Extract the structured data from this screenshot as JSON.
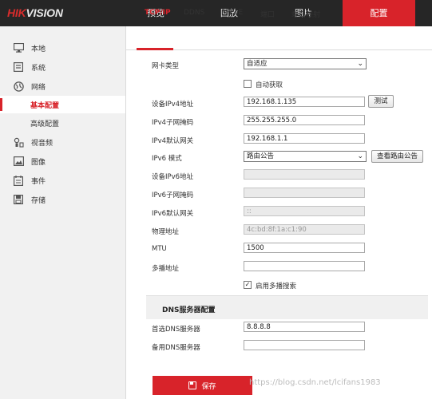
{
  "brand": {
    "logo_hik": "HIK",
    "logo_vision": "VISION"
  },
  "nav": {
    "tabs": [
      {
        "label": "预览"
      },
      {
        "label": "回放"
      },
      {
        "label": "图片"
      },
      {
        "label": "配置"
      }
    ],
    "active": "配置",
    "accent_color": "#d8232a"
  },
  "sidebar": {
    "items": [
      {
        "label": "本地",
        "icon": "monitor-icon"
      },
      {
        "label": "系统",
        "icon": "system-icon"
      },
      {
        "label": "网络",
        "icon": "globe-icon"
      },
      {
        "label": "基本配置",
        "icon": ""
      },
      {
        "label": "高级配置",
        "icon": ""
      },
      {
        "label": "视音频",
        "icon": "audio-video-icon"
      },
      {
        "label": "图像",
        "icon": "image-icon"
      },
      {
        "label": "事件",
        "icon": "event-icon"
      },
      {
        "label": "存储",
        "icon": "storage-icon"
      }
    ],
    "active": "基本配置"
  },
  "subtabs": {
    "items": [
      "TCP/IP",
      "DDNS",
      "PPPoE",
      "端口",
      "端口映射"
    ],
    "active": "TCP/IP"
  },
  "form": {
    "nic_type_label": "网卡类型",
    "nic_type_value": "自适应",
    "dhcp_label": "自动获取",
    "dhcp_checked": false,
    "ipv4_addr_label": "设备IPv4地址",
    "ipv4_addr_value": "192.168.1.135",
    "test_button": "测试",
    "ipv4_mask_label": "IPv4子网掩码",
    "ipv4_mask_value": "255.255.255.0",
    "ipv4_gateway_label": "IPv4默认网关",
    "ipv4_gateway_value": "192.168.1.1",
    "ipv6_mode_label": "IPv6 模式",
    "ipv6_mode_value": "路由公告",
    "view_route_button": "查看路由公告",
    "ipv6_addr_label": "设备IPv6地址",
    "ipv6_addr_value": "",
    "ipv6_mask_label": "IPv6子网掩码",
    "ipv6_mask_value": "",
    "ipv6_gateway_label": "IPv6默认网关",
    "ipv6_gateway_value": "::",
    "mac_label": "物理地址",
    "mac_value": "4c:bd:8f:1a:c1:90",
    "mtu_label": "MTU",
    "mtu_value": "1500",
    "multicast_label": "多播地址",
    "multicast_value": "",
    "multicast_search_label": "启用多播搜索",
    "multicast_search_checked": true
  },
  "dns": {
    "section_title": "DNS服务器配置",
    "preferred_label": "首选DNS服务器",
    "preferred_value": "8.8.8.8",
    "alternate_label": "备用DNS服务器",
    "alternate_value": ""
  },
  "actions": {
    "save_label": "保存"
  },
  "watermark": "https://blog.csdn.net/lcifans1983"
}
